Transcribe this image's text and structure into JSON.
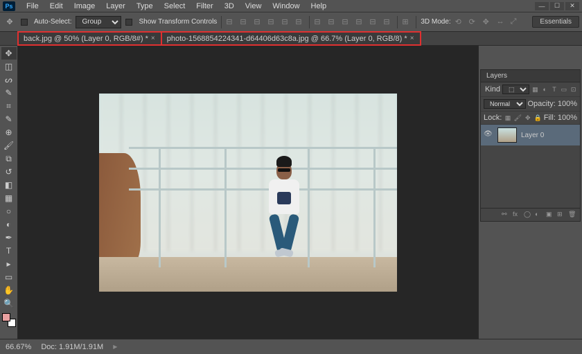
{
  "app": {
    "logo": "Ps"
  },
  "menu": [
    "File",
    "Edit",
    "Image",
    "Layer",
    "Type",
    "Select",
    "Filter",
    "3D",
    "View",
    "Window",
    "Help"
  ],
  "options": {
    "auto_select_label": "Auto-Select:",
    "auto_select_value": "Group",
    "show_transform_label": "Show Transform Controls",
    "mode_3d": "3D Mode:"
  },
  "workspace": "Essentials",
  "tabs": [
    {
      "label": "back.jpg @ 50% (Layer 0, RGB/8#) *"
    },
    {
      "label": "photo-1568854224341-d64406d63c8a.jpg @ 66.7% (Layer 0, RGB/8) *"
    }
  ],
  "layers_panel": {
    "title": "Layers",
    "kind": "Kind",
    "blend_mode": "Normal",
    "opacity_label": "Opacity:",
    "opacity_value": "100%",
    "lock_label": "Lock:",
    "fill_label": "Fill:",
    "fill_value": "100%",
    "layers": [
      {
        "name": "Layer 0"
      }
    ]
  },
  "status": {
    "zoom": "66.67%",
    "doc": "Doc: 1.91M/1.91M"
  }
}
